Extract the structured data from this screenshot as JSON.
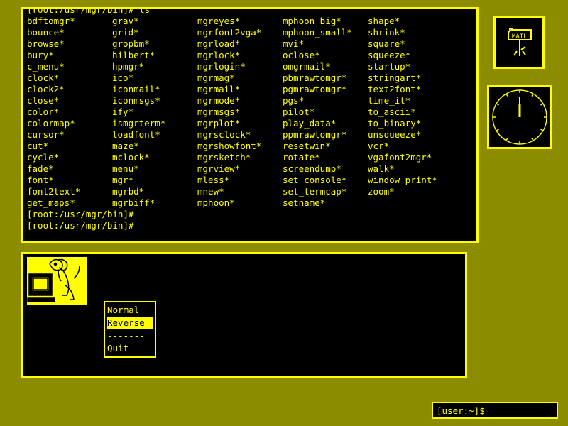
{
  "terminal": {
    "rows": [
      [
        "[root:/usr/mgr/bin]# ls",
        "",
        "",
        "",
        ""
      ],
      [
        "bdftomgr*",
        "grav*",
        "mgreyes*",
        "mphoon_big*",
        "shape*"
      ],
      [
        "bounce*",
        "grid*",
        "mgrfont2vga*",
        "mphoon_small*",
        "shrink*"
      ],
      [
        "browse*",
        "gropbm*",
        "mgrload*",
        "mvi*",
        "square*"
      ],
      [
        "bury*",
        "hilbert*",
        "mgrlock*",
        "oclose*",
        "squeeze*"
      ],
      [
        "c_menu*",
        "hpmgr*",
        "mgrlogin*",
        "omgrmail*",
        "startup*"
      ],
      [
        "clock*",
        "ico*",
        "mgrmag*",
        "pbmrawtomgr*",
        "stringart*"
      ],
      [
        "clock2*",
        "iconmail*",
        "mgrmail*",
        "pgmrawtomgr*",
        "text2font*"
      ],
      [
        "close*",
        "iconmsgs*",
        "mgrmode*",
        "pgs*",
        "time_it*"
      ],
      [
        "color*",
        "ify*",
        "mgrmsgs*",
        "pilot*",
        "to_ascii*"
      ],
      [
        "colormap*",
        "ismgrterm*",
        "mgrplot*",
        "play_data*",
        "to_binary*"
      ],
      [
        "cursor*",
        "loadfont*",
        "mgrsclock*",
        "ppmrawtomgr*",
        "unsqueeze*"
      ],
      [
        "cut*",
        "maze*",
        "mgrshowfont*",
        "resetwin*",
        "vcr*"
      ],
      [
        "cycle*",
        "mclock*",
        "mgrsketch*",
        "rotate*",
        "vgafont2mgr*"
      ],
      [
        "fade*",
        "menu*",
        "mgrview*",
        "screendump*",
        "walk*"
      ],
      [
        "font*",
        "mgr*",
        "mless*",
        "set_console*",
        "window_print*"
      ],
      [
        "font2text*",
        "mgrbd*",
        "mnew*",
        "set_termcap*",
        "zoom*"
      ],
      [
        "get_maps*",
        "mgrbiff*",
        "mphoon*",
        "setname*",
        ""
      ]
    ],
    "prompt_lines": [
      "[root:/usr/mgr/bin]#",
      "[root:/usr/mgr/bin]#"
    ]
  },
  "mail_icon": {
    "label": "MAIL"
  },
  "clock": {
    "hour_hand_deg": 0,
    "minute_hand_deg": 0
  },
  "menu": {
    "items": [
      "Normal",
      "Reverse",
      "-------",
      "Quit"
    ],
    "selected_index": 1
  },
  "shell_prompt": "[user:~]$",
  "colors": {
    "fg": "#ffff00",
    "bg": "#000000"
  }
}
